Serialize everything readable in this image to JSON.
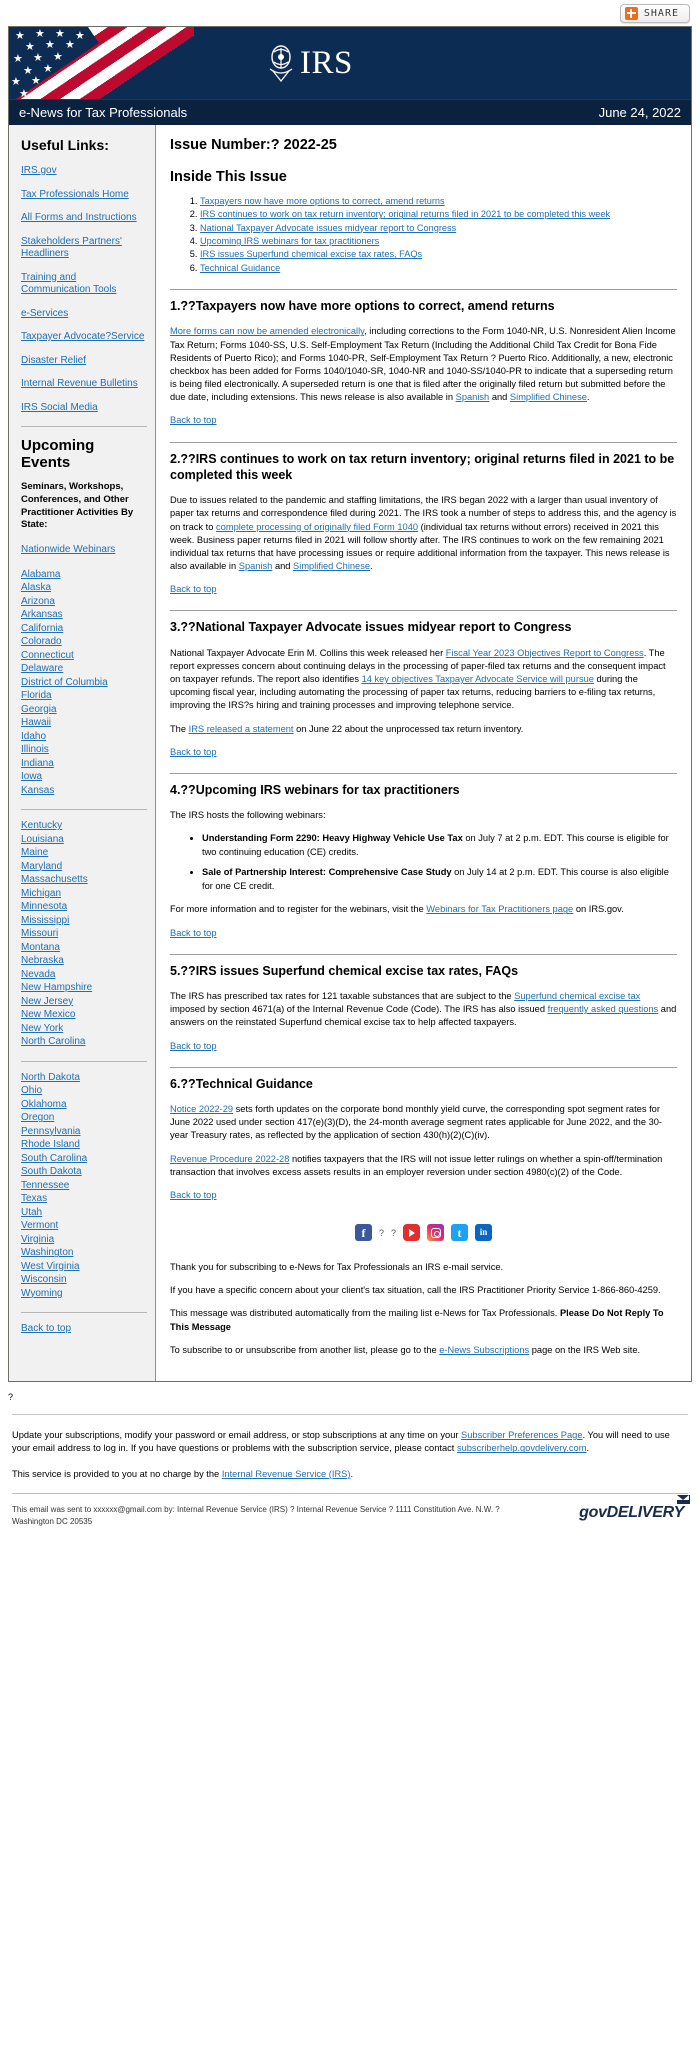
{
  "share": {
    "label": "SHARE"
  },
  "masthead": {
    "logo_text": "IRS",
    "publication": "e-News for Tax Professionals",
    "date": "June 24, 2022"
  },
  "sidebar": {
    "useful_links_heading": "Useful Links:",
    "useful_links": [
      "IRS.gov",
      "Tax Professionals Home",
      "All Forms and Instructions",
      "Stakeholders Partners' Headliners",
      "Training and Communication Tools",
      "e-Services",
      "Taxpayer Advocate?Service",
      "Disaster Relief",
      "Internal Revenue Bulletins",
      "IRS Social Media"
    ],
    "events_heading": "Upcoming Events",
    "events_sub": "Seminars, Workshops, Conferences, and Other Practitioner Activities By State:",
    "nationwide": "Nationwide Webinars",
    "states_group1": [
      "Alabama",
      "Alaska",
      "Arizona",
      "Arkansas",
      "California",
      "Colorado",
      "Connecticut",
      "Delaware",
      "District of Columbia",
      "Florida",
      "Georgia",
      "Hawaii",
      "Idaho",
      "Illinois",
      "Indiana",
      "Iowa",
      "Kansas"
    ],
    "states_group2": [
      "Kentucky",
      "Louisiana",
      "Maine",
      "Maryland",
      "Massachusetts",
      "Michigan",
      "Minnesota",
      "Mississippi",
      "Missouri",
      "Montana",
      "Nebraska",
      "Nevada",
      "New Hampshire",
      "New Jersey",
      "New Mexico",
      "New York",
      "North Carolina"
    ],
    "states_group3": [
      "North Dakota",
      "Ohio",
      "Oklahoma",
      "Oregon",
      "Pennsylvania",
      "Rhode Island",
      "South Carolina",
      "South Dakota",
      "Tennessee",
      "Texas",
      "Utah",
      "Vermont",
      "Virginia",
      "Washington",
      "West Virginia",
      "Wisconsin",
      "Wyoming"
    ],
    "back_to_top": "Back to top"
  },
  "main": {
    "issue_number": "Issue Number:? 2022-25",
    "inside_heading": "Inside This Issue",
    "toc": [
      "Taxpayers now have more options to correct, amend returns",
      "IRS continues to work on tax return inventory; original returns filed in 2021 to be completed this week",
      "National Taxpayer Advocate issues midyear report to Congress",
      "Upcoming IRS webinars for tax practitioners",
      "IRS issues Superfund chemical excise tax rates, FAQs",
      "Technical Guidance"
    ],
    "back_to_top": "Back to top",
    "sections": [
      {
        "heading": "1.??Taxpayers now have more options to correct, amend returns",
        "paragraphs": [
          {
            "parts": [
              {
                "t": "link",
                "v": "More forms can now be amended electronically"
              },
              {
                "t": "text",
                "v": ", including corrections to the Form 1040-NR, U.S. Nonresident Alien Income Tax Return; Forms 1040-SS, U.S. Self-Employment Tax Return (Including the Additional Child Tax Credit for Bona Fide Residents of Puerto Rico); and Forms 1040-PR, Self-Employment Tax Return ? Puerto Rico. Additionally, a new, electronic checkbox has been added for Forms 1040/1040-SR, 1040-NR and 1040-SS/1040-PR to indicate that a superseding return is being filed electronically. A superseded return is one that is filed after the originally filed return but submitted before the due date, including extensions. This news release is also available in "
              },
              {
                "t": "link",
                "v": "Spanish"
              },
              {
                "t": "text",
                "v": " and "
              },
              {
                "t": "link",
                "v": "Simplified Chinese"
              },
              {
                "t": "text",
                "v": "."
              }
            ]
          }
        ]
      },
      {
        "heading": "2.??IRS continues to work on tax return inventory; original returns filed in 2021 to be completed this week",
        "paragraphs": [
          {
            "parts": [
              {
                "t": "text",
                "v": "Due to issues related to the pandemic and staffing limitations, the IRS began 2022 with a larger than usual inventory of paper tax returns and correspondence filed during 2021. The IRS took a number of steps to address this, and the agency is on track to "
              },
              {
                "t": "link",
                "v": "complete processing of originally filed Form 1040"
              },
              {
                "t": "text",
                "v": " (individual tax returns without errors) received in 2021 this week. Business paper returns filed in 2021 will follow shortly after. The IRS continues to work on the few remaining 2021 individual tax returns that have processing issues or require additional information from the taxpayer. This news release is also available in "
              },
              {
                "t": "link",
                "v": "Spanish"
              },
              {
                "t": "text",
                "v": " and "
              },
              {
                "t": "link",
                "v": "Simplified Chinese"
              },
              {
                "t": "text",
                "v": "."
              }
            ]
          }
        ]
      },
      {
        "heading": "3.??National Taxpayer Advocate issues midyear report to Congress",
        "paragraphs": [
          {
            "parts": [
              {
                "t": "text",
                "v": "National Taxpayer Advocate Erin M. Collins this week released her "
              },
              {
                "t": "link",
                "v": "Fiscal Year 2023 Objectives Report to Congress"
              },
              {
                "t": "text",
                "v": ". The report expresses concern about continuing delays in the processing of paper-filed tax returns and the consequent impact on taxpayer refunds. The report also identifies "
              },
              {
                "t": "link",
                "v": "14 key objectives Taxpayer Advocate Service will pursue"
              },
              {
                "t": "text",
                "v": " during the upcoming fiscal year, including automating the processing of paper tax returns, reducing barriers to e-filing tax returns, improving the IRS?s hiring and training processes and improving telephone service."
              }
            ]
          },
          {
            "parts": [
              {
                "t": "text",
                "v": "The "
              },
              {
                "t": "link",
                "v": "IRS released a statement"
              },
              {
                "t": "text",
                "v": " on June 22 about the unprocessed tax return inventory."
              }
            ]
          }
        ]
      },
      {
        "heading": "4.??Upcoming IRS webinars for tax practitioners",
        "paragraphs": [
          {
            "parts": [
              {
                "t": "text",
                "v": "The IRS hosts the following webinars:"
              }
            ]
          }
        ],
        "bullets": [
          {
            "bold": "Understanding Form 2290: Heavy Highway Vehicle Use Tax",
            "rest": " on July 7 at 2 p.m. EDT. This course is eligible for two continuing education (CE) credits."
          },
          {
            "bold": "Sale of Partnership Interest: Comprehensive Case Study",
            "rest": " on July 14 at 2 p.m. EDT. This course is also eligible for one CE credit."
          }
        ],
        "after_bullets": [
          {
            "parts": [
              {
                "t": "text",
                "v": "For more information and to register for the webinars, visit the "
              },
              {
                "t": "link",
                "v": "Webinars for Tax Practitioners page"
              },
              {
                "t": "text",
                "v": " on IRS.gov."
              }
            ]
          }
        ]
      },
      {
        "heading": "5.??IRS issues Superfund chemical excise tax rates, FAQs",
        "paragraphs": [
          {
            "parts": [
              {
                "t": "text",
                "v": "The IRS has prescribed tax rates for 121 taxable substances that are subject to the "
              },
              {
                "t": "link",
                "v": "Superfund chemical excise tax"
              },
              {
                "t": "text",
                "v": " imposed by section 4671(a) of the Internal Revenue Code (Code). The IRS has also issued "
              },
              {
                "t": "link",
                "v": "frequently asked questions"
              },
              {
                "t": "text",
                "v": " and answers on the reinstated Superfund chemical excise tax to help affected taxpayers."
              }
            ]
          }
        ]
      },
      {
        "heading": "6.??Technical Guidance",
        "paragraphs": [
          {
            "parts": [
              {
                "t": "link",
                "v": "Notice 2022-29"
              },
              {
                "t": "text",
                "v": " sets forth updates on the corporate bond monthly yield curve, the corresponding spot segment rates for June 2022 used under section 417(e)(3)(D), the 24-month average segment rates applicable for June 2022, and the 30-year Treasury rates, as reflected by the application of section 430(h)(2)(C)(iv)."
              }
            ]
          },
          {
            "parts": [
              {
                "t": "link",
                "v": "Revenue Procedure 2022-28"
              },
              {
                "t": "text",
                "v": " notifies taxpayers that the IRS will not issue letter rulings on whether a spin-off/termination transaction that involves excess assets results in an employer reversion under section 4980(c)(2) of the Code."
              }
            ]
          }
        ]
      }
    ],
    "social_icons": [
      {
        "name": "facebook-icon",
        "glyph": "f"
      },
      {
        "name": "question-mark-1",
        "glyph": "?"
      },
      {
        "name": "question-mark-2",
        "glyph": "?"
      },
      {
        "name": "youtube-icon",
        "glyph": ""
      },
      {
        "name": "instagram-icon",
        "glyph": ""
      },
      {
        "name": "twitter-icon",
        "glyph": "t"
      },
      {
        "name": "linkedin-icon",
        "glyph": "in"
      }
    ],
    "closing": {
      "thanks": "Thank you for subscribing to e-News for Tax Professionals an IRS e-mail service.",
      "concern_pre": "If you have a specific concern about your client's tax situation, call the IRS Practitioner Priority Service 1-866-860-4259.",
      "distribution_pre": "This message was distributed automatically from the mailing list e-News for Tax Professionals. ",
      "distribution_bold": "Please Do Not Reply To This Message",
      "subscribe_pre": "To subscribe to or unsubscribe from another list, please go to the ",
      "subscribe_link": "e-News Subscriptions",
      "subscribe_post": " page on the IRS Web site."
    }
  },
  "outer_footer": {
    "stray_mark": "?",
    "update_pre": "Update your subscriptions, modify your password or email address, or stop subscriptions at any time on your ",
    "update_link": "Subscriber Preferences Page",
    "update_mid": ". You will need to use your email address to log in. If you have questions or problems with the subscription service, please contact ",
    "update_link2": "subscriberhelp.govdelivery.com",
    "update_post": ".",
    "service_pre": "This service is provided to you at no charge by the ",
    "service_link": "Internal Revenue Service (IRS)",
    "service_post": ".",
    "address": "This email was sent to xxxxxx@gmail.com by: Internal Revenue Service (IRS) ? Internal Revenue Service ? 1111 Constitution Ave. N.W. ? Washington DC 20535",
    "brand": "govDELIVERY"
  },
  "colors": {
    "navy": "#0d2c54",
    "title_bar": "#0a2240",
    "link": "#1f6fb2",
    "flag_red": "#bf0a30",
    "sidebar_bg": "#f1f1f1",
    "share_orange": "#ef6c1a"
  }
}
